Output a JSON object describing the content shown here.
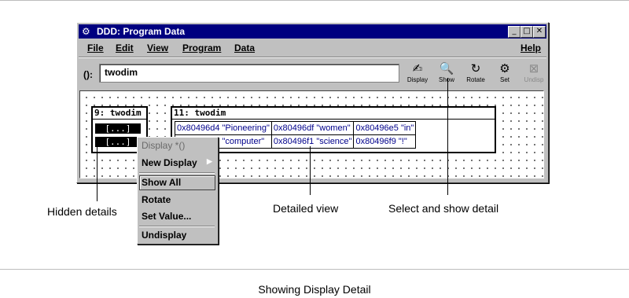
{
  "window": {
    "title": "DDD: Program Data",
    "menus": [
      "File",
      "Edit",
      "View",
      "Program",
      "Data"
    ],
    "help": "Help",
    "arg_label": "():",
    "arg_value": "twodim"
  },
  "toolbar": [
    {
      "label": "Display",
      "icon": "display-icon"
    },
    {
      "label": "Show",
      "icon": "magnifier-icon"
    },
    {
      "label": "Rotate",
      "icon": "rotate-icon"
    },
    {
      "label": "Set",
      "icon": "set-icon"
    },
    {
      "label": "Undisp",
      "icon": "undisplay-icon",
      "disabled": true
    }
  ],
  "displays": {
    "small": {
      "title": "9: twodim",
      "cells": [
        "[...]",
        "[...]"
      ]
    },
    "large": {
      "title": "11: twodim",
      "rows": [
        [
          "0x80496d4 \"Pioneering\"",
          "0x80496df \"women\"",
          "0x80496e5 \"in\""
        ],
        [
          "0x80496e8 \"computer\"",
          "0x80496f1 \"science\"",
          "0x80496f9 \"!\""
        ]
      ]
    }
  },
  "popup": {
    "items": [
      "Display *()",
      "New Display",
      "Show All",
      "Rotate",
      "Set Value...",
      "Undisplay"
    ]
  },
  "callouts": {
    "hidden": "Hidden details",
    "detailed": "Detailed view",
    "select": "Select and show detail"
  },
  "caption": "Showing Display Detail"
}
